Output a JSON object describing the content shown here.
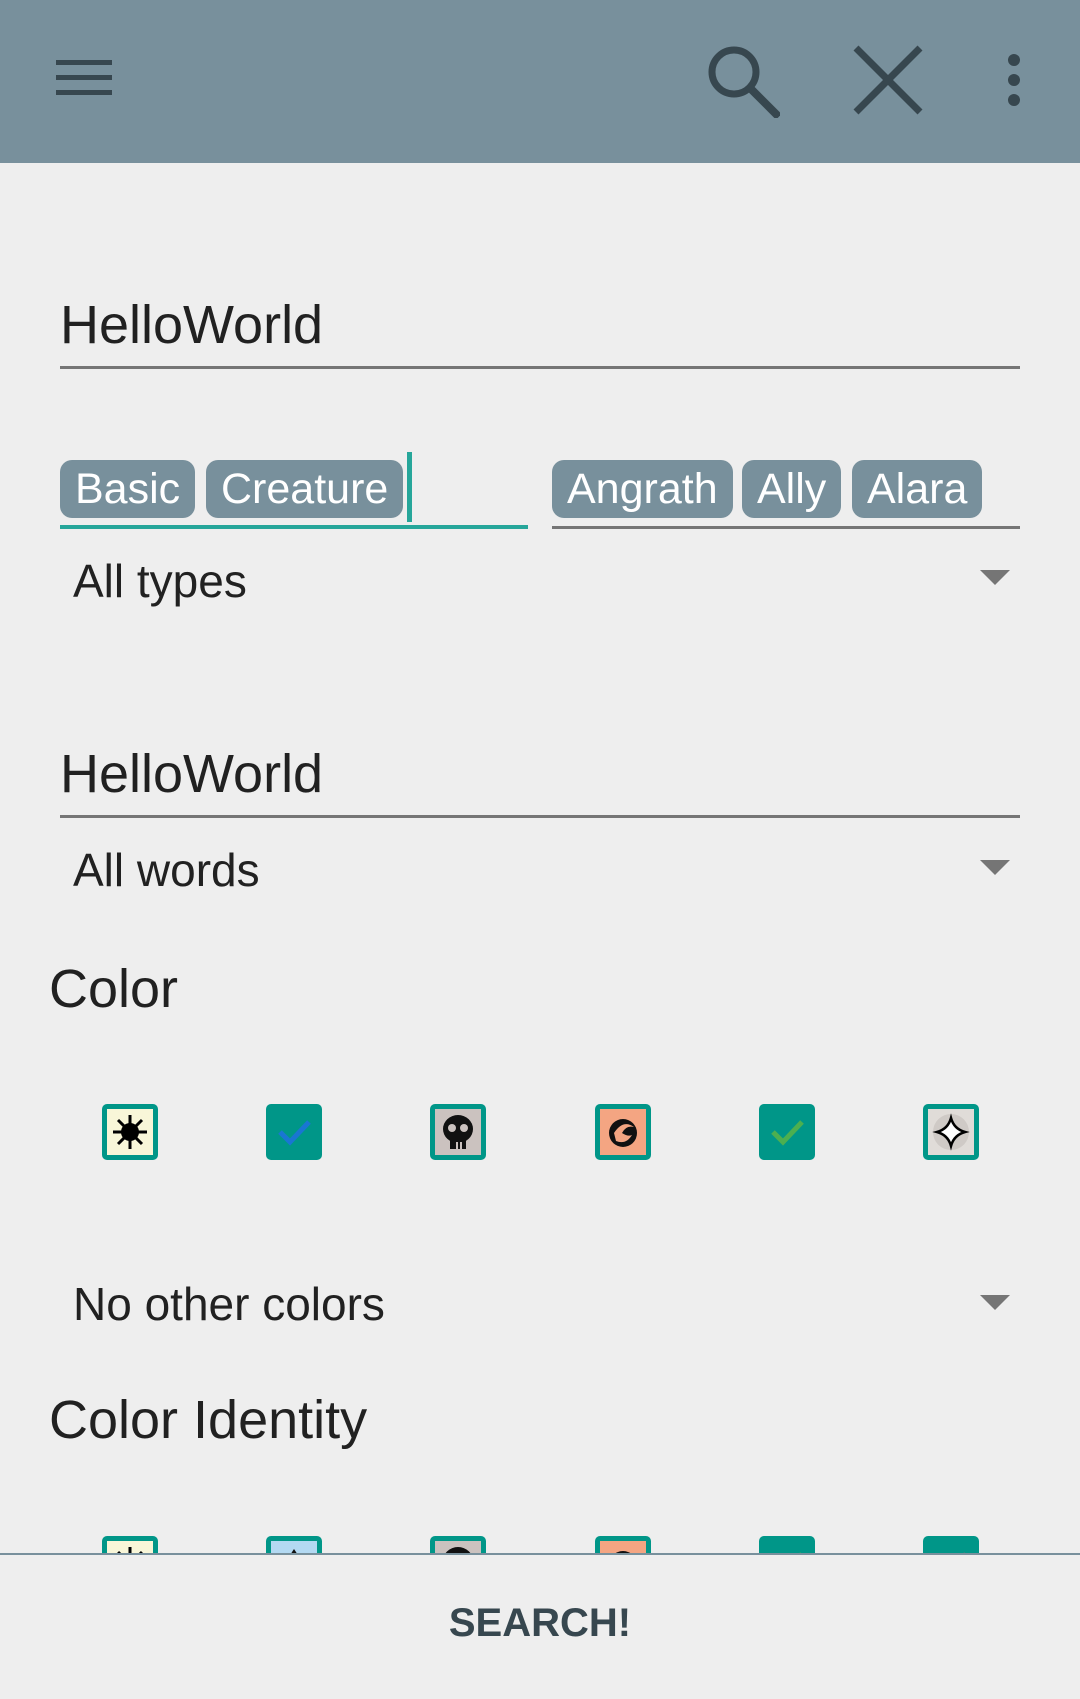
{
  "colors": {
    "appbar": "#78909c",
    "accent": "#009688",
    "chip_background": "#78909c",
    "background": "#eeeeee"
  },
  "appbar": {
    "icons": [
      "menu-icon",
      "search-icon",
      "close-icon",
      "more-vert-icon"
    ]
  },
  "name_field": {
    "value": "HelloWorld"
  },
  "supertype_field": {
    "chips": [
      "Basic",
      "Creature"
    ]
  },
  "subtype_field": {
    "chips": [
      "Angrath",
      "Ally",
      "Alara"
    ]
  },
  "type_logic": {
    "selected": "All types"
  },
  "text_field": {
    "value": "HelloWorld"
  },
  "text_logic": {
    "selected": "All words"
  },
  "color_section": {
    "title": "Color",
    "checkboxes": [
      {
        "color": "white",
        "icon": "white-mana-icon",
        "checked": false
      },
      {
        "color": "blue",
        "icon": "blue-mana-icon",
        "checked": true
      },
      {
        "color": "black",
        "icon": "black-mana-icon",
        "checked": false
      },
      {
        "color": "red",
        "icon": "red-mana-icon",
        "checked": false
      },
      {
        "color": "green",
        "icon": "green-mana-icon",
        "checked": true
      },
      {
        "color": "colorless",
        "icon": "colorless-mana-icon",
        "checked": false
      }
    ],
    "logic": {
      "selected": "No other colors"
    }
  },
  "color_identity_section": {
    "title": "Color Identity",
    "checkboxes": [
      {
        "color": "white",
        "icon": "white-mana-icon",
        "checked": false
      },
      {
        "color": "blue",
        "icon": "blue-mana-icon",
        "checked": false
      },
      {
        "color": "black",
        "icon": "black-mana-icon",
        "checked": false
      },
      {
        "color": "red",
        "icon": "red-mana-icon",
        "checked": false
      },
      {
        "color": "green",
        "icon": "green-mana-icon",
        "checked": true
      },
      {
        "color": "colorless",
        "icon": "colorless-mana-icon",
        "checked": true
      }
    ]
  },
  "search_button": {
    "label": "SEARCH!"
  }
}
